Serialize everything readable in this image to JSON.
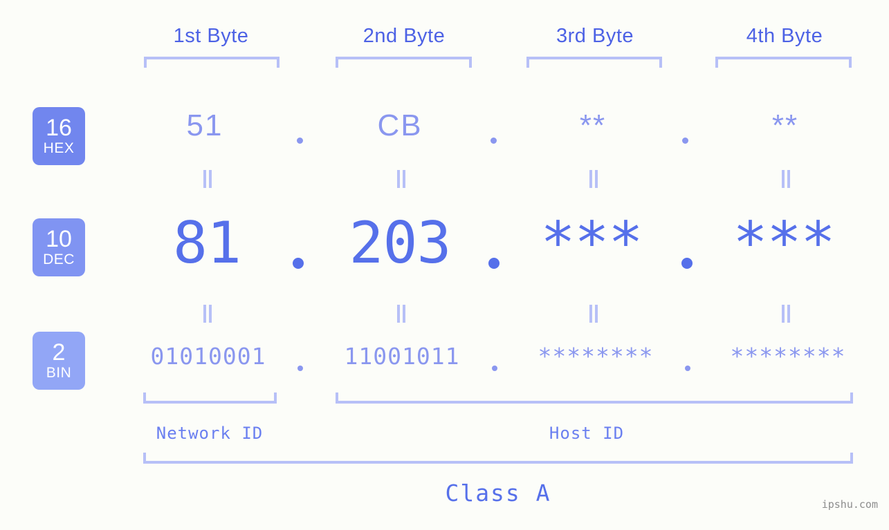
{
  "page": {
    "background": "#fcfdf9",
    "accent": "#5670ea",
    "accent_light": "#8a97ef",
    "bracket_color": "#b7c0f7",
    "watermark": "ipshu.com"
  },
  "byte_headers": [
    {
      "label": "1st Byte"
    },
    {
      "label": "2nd Byte"
    },
    {
      "label": "3rd Byte"
    },
    {
      "label": "4th Byte"
    }
  ],
  "bases": [
    {
      "number": "16",
      "abbr": "HEX",
      "color": "#7186ee"
    },
    {
      "number": "10",
      "abbr": "DEC",
      "color": "#8094f2"
    },
    {
      "number": "2",
      "abbr": "BIN",
      "color": "#92a6f6"
    }
  ],
  "rows": {
    "hex": {
      "values": [
        "51",
        "CB",
        "**",
        "**"
      ]
    },
    "dec": {
      "values": [
        "81",
        "203",
        "***",
        "***"
      ]
    },
    "bin": {
      "values": [
        "01010001",
        "11001011",
        "********",
        "********"
      ]
    }
  },
  "separators": {
    "dot": ".",
    "equals": "||"
  },
  "id_labels": [
    {
      "label": "Network ID"
    },
    {
      "label": "Host ID"
    }
  ],
  "class_label": "Class A"
}
